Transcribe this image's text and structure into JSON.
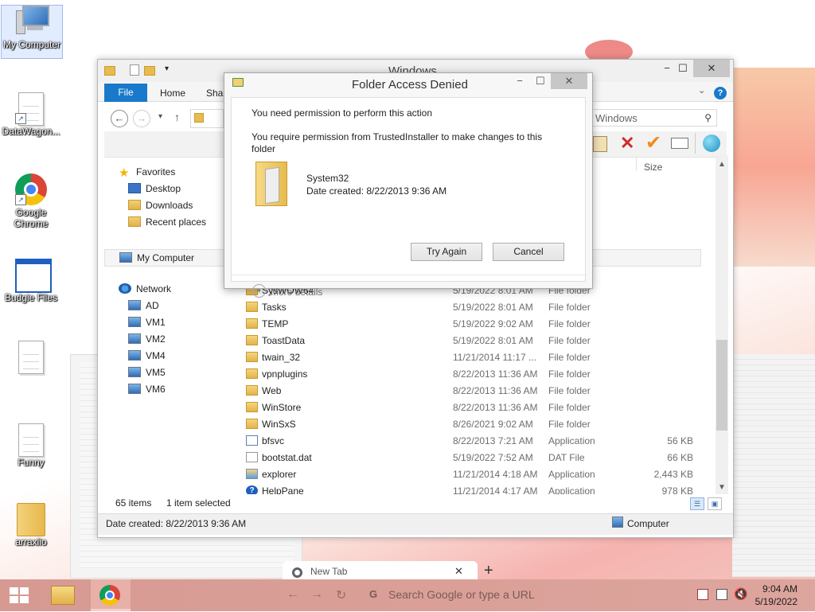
{
  "desktop": {
    "icons": [
      {
        "label": "My Computer",
        "icon": "computer-icon"
      },
      {
        "label": "DataWagon...",
        "icon": "document-shortcut-icon"
      },
      {
        "label": "Google Chrome",
        "icon": "chrome-icon"
      },
      {
        "label": "Budgie Files",
        "icon": "window-icon"
      },
      {
        "label": "",
        "icon": "document-icon"
      },
      {
        "label": "Funny",
        "icon": "document-icon"
      },
      {
        "label": "arraxiio",
        "icon": "folder-icon"
      }
    ]
  },
  "explorer": {
    "title": "Windows",
    "ribbon_tabs": [
      "File",
      "Home",
      "Shar"
    ],
    "search_placeholder": "Windows",
    "nav_pane": {
      "favorites_label": "Favorites",
      "favorites": [
        "Desktop",
        "Downloads",
        "Recent places"
      ],
      "my_computer_label": "My Computer",
      "network_label": "Network",
      "network_items": [
        "AD",
        "VM1",
        "VM2",
        "VM4",
        "VM5",
        "VM6"
      ]
    },
    "column_size_label": "Size",
    "partial_row": {
      "name": "SysWOW64",
      "date": "5/19/2022 8:01 AM",
      "type": "File folder"
    },
    "files": [
      {
        "name": "Tasks",
        "date": "5/19/2022 8:01 AM",
        "type": "File folder",
        "size": "",
        "kind": "folder"
      },
      {
        "name": "TEMP",
        "date": "5/19/2022 9:02 AM",
        "type": "File folder",
        "size": "",
        "kind": "folder"
      },
      {
        "name": "ToastData",
        "date": "5/19/2022 8:01 AM",
        "type": "File folder",
        "size": "",
        "kind": "folder"
      },
      {
        "name": "twain_32",
        "date": "11/21/2014 11:17 ...",
        "type": "File folder",
        "size": "",
        "kind": "folder"
      },
      {
        "name": "vpnplugins",
        "date": "8/22/2013 11:36 AM",
        "type": "File folder",
        "size": "",
        "kind": "folder"
      },
      {
        "name": "Web",
        "date": "8/22/2013 11:36 AM",
        "type": "File folder",
        "size": "",
        "kind": "folder"
      },
      {
        "name": "WinStore",
        "date": "8/22/2013 11:36 AM",
        "type": "File folder",
        "size": "",
        "kind": "folder"
      },
      {
        "name": "WinSxS",
        "date": "8/26/2021 9:02 AM",
        "type": "File folder",
        "size": "",
        "kind": "folder"
      },
      {
        "name": "bfsvc",
        "date": "8/22/2013 7:21 AM",
        "type": "Application",
        "size": "56 KB",
        "kind": "app"
      },
      {
        "name": "bootstat.dat",
        "date": "5/19/2022 7:52 AM",
        "type": "DAT File",
        "size": "66 KB",
        "kind": "dat"
      },
      {
        "name": "explorer",
        "date": "11/21/2014 4:18 AM",
        "type": "Application",
        "size": "2,443 KB",
        "kind": "exp"
      },
      {
        "name": "HelpPane",
        "date": "11/21/2014 4:17 AM",
        "type": "Application",
        "size": "978 KB",
        "kind": "help"
      }
    ],
    "status_items": "65 items",
    "status_selected": "1 item selected",
    "details_bar_text": "Date created: 8/22/2013 9:36 AM",
    "details_bar_location": "Computer"
  },
  "dialog": {
    "title": "Folder Access Denied",
    "heading": "You need permission to perform this action",
    "message": "You require permission from TrustedInstaller to make changes to this folder",
    "item_name": "System32",
    "item_date": "Date created: 8/22/2013 9:36 AM",
    "try_again_label": "Try Again",
    "cancel_label": "Cancel",
    "more_details_label": "More details"
  },
  "chrome": {
    "tab_title": "New Tab",
    "omnibox_placeholder": "Search Google or type a URL"
  },
  "taskbar": {
    "time": "9:04 AM",
    "date": "5/19/2022"
  },
  "colors": {
    "accent": "#1979ca",
    "taskbar": "#d79a92"
  }
}
